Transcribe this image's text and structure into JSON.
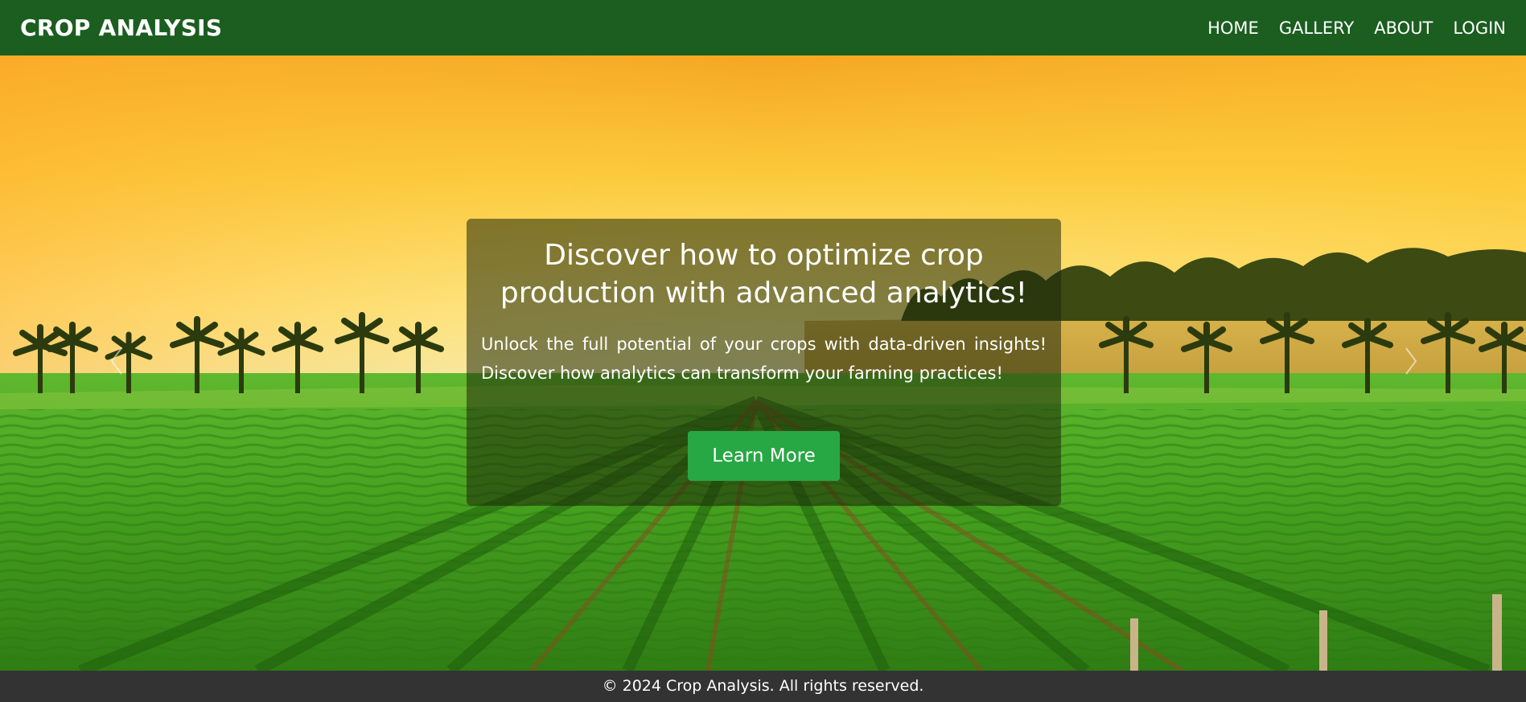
{
  "navbar": {
    "brand": "CROP ANALYSIS",
    "links": [
      "HOME",
      "GALLERY",
      "ABOUT",
      "LOGIN"
    ]
  },
  "hero": {
    "heading": "Discover how to optimize crop production with advanced analytics!",
    "body": "Unlock the full potential of your crops with data-driven insights! Discover how analytics can transform your farming practices!",
    "cta_label": "Learn More"
  },
  "footer": {
    "text": "© 2024 Crop Analysis. All rights reserved."
  },
  "colors": {
    "navbar_bg": "#1b5e20",
    "cta_bg": "#28a745",
    "footer_bg": "#333333"
  }
}
